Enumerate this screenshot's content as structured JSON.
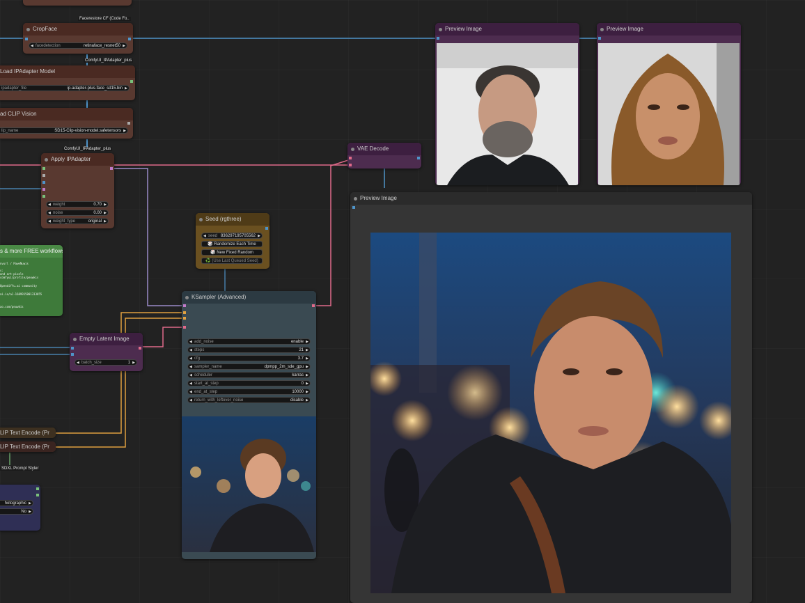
{
  "nodes": {
    "facerestore_label": "Facerestore CF (Code Fo..",
    "cropface": {
      "title": "CropFace",
      "widget_label": "facedetection",
      "widget_value": "retinaface_resnet50",
      "output_label": "ComfyUI_IPAdapter_plus"
    },
    "load_ipadapter": {
      "title": "Load IPAdapter Model",
      "widget_label": "ipadapter_file",
      "widget_value": "ip-adapter-plus-face_sd15.bin"
    },
    "load_clip_vision": {
      "title": "ad CLIP Vision",
      "widget_label": "lip_name",
      "widget_value": "SD15-Clip-vision-model.safetensors",
      "output_label": "ComfyUI_IPAdapter_plus"
    },
    "apply_ipadapter": {
      "title": "Apply IPAdapter",
      "widgets": [
        {
          "label": "weight",
          "value": "0.70"
        },
        {
          "label": "noise",
          "value": "0.00"
        },
        {
          "label": "weight_type",
          "value": "original"
        }
      ]
    },
    "seed": {
      "title": "Seed (rgthree)",
      "widget_label": "seed",
      "widget_value": "836297195705562",
      "buttons": [
        "🎲 Randomize Each Time",
        "🎲 New Fixed Random",
        "♻️ (Use Last Queued Seed)"
      ]
    },
    "free_workflows": {
      "title": "s & more FREE workflows",
      "lines": [
        "nvurl / PaweNuwis",
        "s:",
        "and art-pixels",
        "comfyui/profile/peuwkis",
        "",
        "Opendiffu.ai community",
        "",
        "ai.io/a1-1689915001313655",
        "",
        "",
        "ao.com/peuwkis"
      ]
    },
    "empty_latent": {
      "title": "Empty Latent Image",
      "widget_label": "batch_size",
      "widget_value": "1"
    },
    "ksampler": {
      "title": "KSampler (Advanced)",
      "widgets": [
        {
          "label": "add_noise",
          "value": "enable"
        },
        {
          "label": "steps",
          "value": "21"
        },
        {
          "label": "cfg",
          "value": "3.7"
        },
        {
          "label": "sampler_name",
          "value": "dpmpp_2m_sde_gpu"
        },
        {
          "label": "scheduler",
          "value": "karras"
        },
        {
          "label": "start_at_step",
          "value": "0"
        },
        {
          "label": "end_at_step",
          "value": "10000"
        },
        {
          "label": "return_with_leftover_noise",
          "value": "disable"
        }
      ]
    },
    "vae_decode": {
      "title": "VAE Decode"
    },
    "preview1": {
      "title": "Preview Image"
    },
    "preview2": {
      "title": "Preview Image"
    },
    "preview3": {
      "title": "Preview Image"
    },
    "clip_text1": {
      "title": "LIP Text Encode (Pr"
    },
    "clip_text2": {
      "title": "LIP Text Encode (Pr"
    },
    "sdxl_styler": {
      "title": "SDXL Prompt Styler",
      "widgets": [
        {
          "label": "",
          "value": "hotographic"
        },
        {
          "label": "",
          "value": "No"
        }
      ]
    }
  },
  "colors": {
    "canvas": "#222222",
    "link_blue": "#4f94c9",
    "link_pink": "#e06a8a",
    "link_lavender": "#9a8ac8",
    "link_orange": "#e0a040",
    "link_cyan": "#6fb8d8"
  }
}
